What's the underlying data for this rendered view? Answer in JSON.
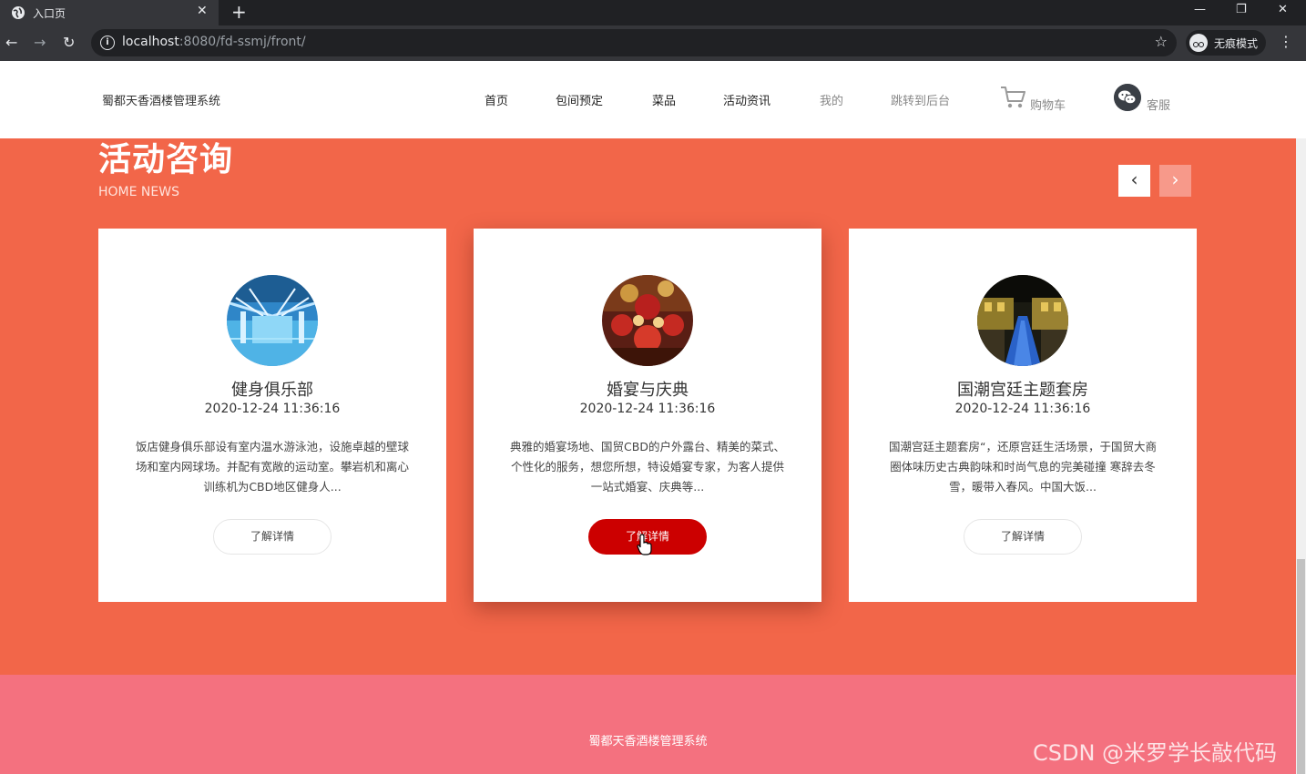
{
  "browser": {
    "tab_title": "入口页",
    "url_host": "localhost",
    "url_rest": ":8080/fd-ssmj/front/",
    "incognito_label": "无痕模式"
  },
  "site": {
    "brand": "蜀都天香酒楼管理系统",
    "nav": [
      "首页",
      "包间预定",
      "菜品",
      "活动资讯",
      "我的",
      "跳转到后台"
    ],
    "cart_label": "购物车",
    "service_label": "客服"
  },
  "activity": {
    "title": "活动咨询",
    "subtitle": "HOME NEWS",
    "prev_arrow": "‹",
    "next_arrow": "›",
    "cards": [
      {
        "title": "健身俱乐部",
        "date": "2020-12-24 11:36:16",
        "description": "饭店健身俱乐部设有室内温水游泳池，设施卓越的壁球场和室内网球场。并配有宽敞的运动室。攀岩机和离心训练机为CBD地区健身人...",
        "button": "了解详情",
        "image": "indoor-pool-photo"
      },
      {
        "title": "婚宴与庆典",
        "date": "2020-12-24 11:36:16",
        "description": "典雅的婚宴场地、国贸CBD的户外露台、精美的菜式、个性化的服务，想您所想，特设婚宴专家，为客人提供一站式婚宴、庆典等...",
        "button": "了解详情",
        "image": "banquet-hall-photo"
      },
      {
        "title": "国潮宫廷主题套房",
        "date": "2020-12-24 11:36:16",
        "description": "国潮宫廷主题套房“，还原宫廷生活场景，于国贸大商圈体味历史古典韵味和时尚气息的完美碰撞 寒辞去冬雪，暖带入春风。中国大饭...",
        "button": "了解详情",
        "image": "palace-courtyard-photo"
      }
    ]
  },
  "footer": {
    "text": "蜀都天香酒楼管理系统"
  },
  "watermark": "CSDN @米罗学长敲代码",
  "colors": {
    "section_bg": "#f26649",
    "footer_bg": "#f4717f",
    "active_button": "#cc0000"
  }
}
